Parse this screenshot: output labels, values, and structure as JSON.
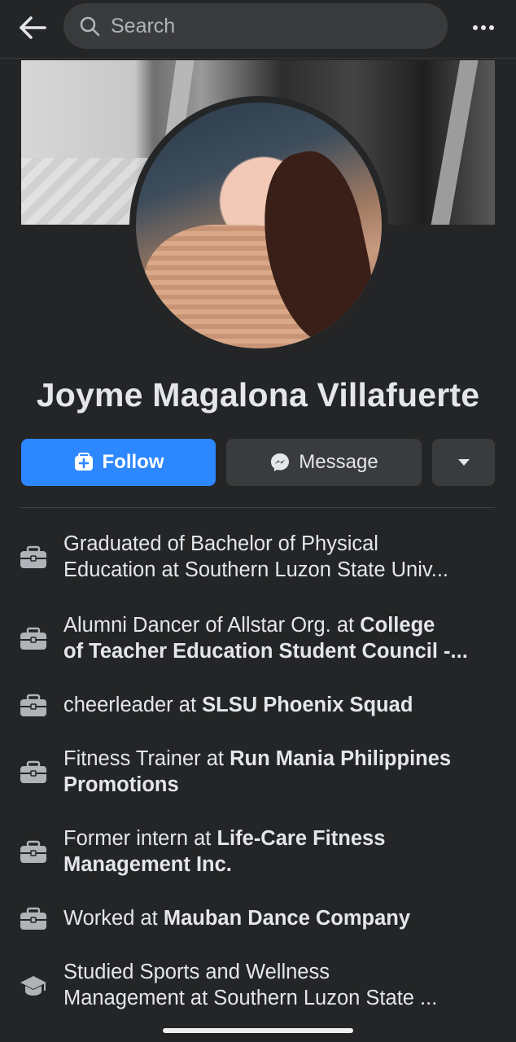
{
  "topbar": {
    "search_placeholder": "Search",
    "back_icon": "arrow-left-icon",
    "more_icon": "more-horizontal-icon"
  },
  "profile": {
    "name": "Joyme Magalona Villafuerte"
  },
  "actions": {
    "follow_label": "Follow",
    "message_label": "Message",
    "more_icon": "caret-down-icon"
  },
  "details": [
    {
      "icon": "briefcase-icon",
      "prefix": "Graduated of Bachelor of Physical",
      "line2": "Education at Southern Luzon State Univ...",
      "bold": ""
    },
    {
      "icon": "briefcase-icon",
      "prefix": "Alumni Dancer of Allstar Org. at ",
      "bold": "College",
      "line2": "of Teacher Education Student Council -..."
    },
    {
      "icon": "briefcase-icon",
      "prefix": "cheerleader at ",
      "bold": "SLSU Phoenix Squad",
      "line2": ""
    },
    {
      "icon": "briefcase-icon",
      "prefix": "Fitness Trainer at ",
      "bold": "Run Mania Philippines",
      "line2": "Promotions"
    },
    {
      "icon": "briefcase-icon",
      "prefix": "Former intern at ",
      "bold": "Life-Care Fitness",
      "line2": "Management Inc."
    },
    {
      "icon": "briefcase-icon",
      "prefix": "Worked at ",
      "bold": "Mauban Dance Company",
      "line2": ""
    },
    {
      "icon": "graduation-cap-icon",
      "prefix": "Studied Sports and Wellness",
      "bold": "",
      "line2": "Management at Southern Luzon State ..."
    }
  ],
  "colors": {
    "background": "#242526",
    "accent": "#2d88ff",
    "button_secondary": "#3a3b3c",
    "text_primary": "#e4e6eb"
  }
}
